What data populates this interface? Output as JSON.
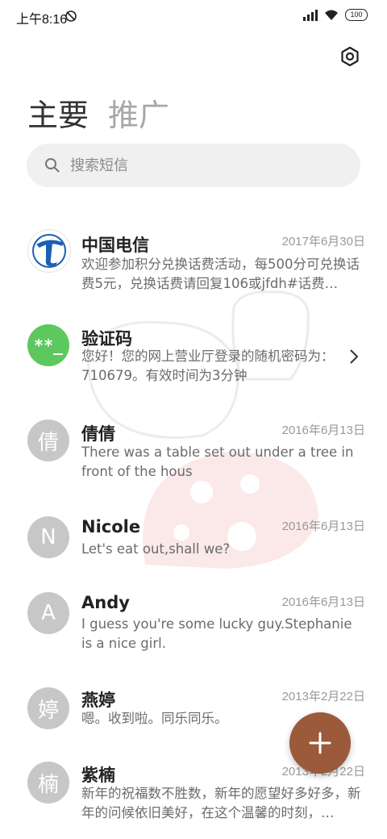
{
  "status_bar": {
    "time": "上午8:16",
    "battery": "100"
  },
  "tabs": [
    {
      "label": "主要",
      "active": true
    },
    {
      "label": "推广",
      "active": false
    }
  ],
  "search": {
    "placeholder": "搜索短信"
  },
  "conversations": [
    {
      "name": "中国电信",
      "date": "2017年6月30日",
      "preview": "欢迎参加积分兑换话费活动，每500分可兑换话费5元，兑换话费请回复106或jfdh#话费…",
      "avatar": "telecom-logo"
    },
    {
      "name": "验证码",
      "date": "",
      "preview": "您好！您的网上营业厅登录的随机密码为：710679。有效时间为3分钟",
      "avatar_text": "**_"
    },
    {
      "name": "倩倩",
      "date": "2016年6月13日",
      "preview": "There was a table set out under a tree in front of the hous",
      "avatar_text": "倩"
    },
    {
      "name": "Nicole",
      "date": "2016年6月13日",
      "preview": "Let's eat out,shall we?",
      "avatar_text": "N"
    },
    {
      "name": "Andy",
      "date": "2016年6月13日",
      "preview": "I guess you're some lucky guy.Stephanie is a nice girl.",
      "avatar_text": "A"
    },
    {
      "name": "燕婷",
      "date": "2013年2月22日",
      "preview": "嗯。收到啦。同乐同乐。",
      "avatar_text": "婷"
    },
    {
      "name": "紫楠",
      "date": "2013年2月22日",
      "preview": "新年的祝福数不胜数，新年的愿望好多好多，新年的问候依旧美好，在这个温馨的时刻，…",
      "avatar_text": "楠"
    }
  ],
  "colors": {
    "fab": "#9b5a3a",
    "verify_avatar": "#5dc85e",
    "gray_avatar": "#c7c7c7"
  },
  "icons": [
    "dnd-icon",
    "signal-icon",
    "wifi-icon",
    "battery-icon",
    "settings-icon",
    "search-icon",
    "chevron-right-icon",
    "plus-icon"
  ]
}
